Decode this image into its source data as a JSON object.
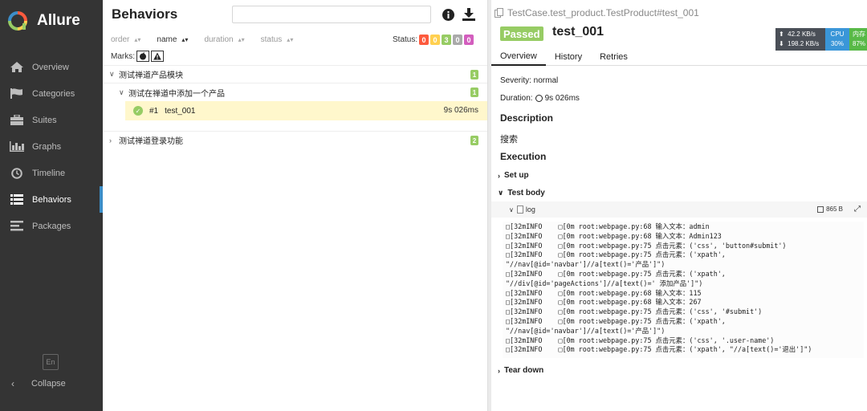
{
  "app": {
    "name": "Allure"
  },
  "sidebar": {
    "items": [
      {
        "label": "Overview",
        "icon": "home-icon"
      },
      {
        "label": "Categories",
        "icon": "flag-icon"
      },
      {
        "label": "Suites",
        "icon": "briefcase-icon"
      },
      {
        "label": "Graphs",
        "icon": "bar-chart-icon"
      },
      {
        "label": "Timeline",
        "icon": "clock-icon"
      },
      {
        "label": "Behaviors",
        "icon": "list-icon",
        "active": true
      },
      {
        "label": "Packages",
        "icon": "align-left-icon"
      }
    ],
    "lang": "En",
    "collapse": "Collapse"
  },
  "behaviors": {
    "title": "Behaviors",
    "search_placeholder": "",
    "sort": {
      "order": "order",
      "name": "name",
      "duration": "duration",
      "status": "status"
    },
    "status_label": "Status:",
    "status_counts": [
      "0",
      "0",
      "3",
      "0",
      "0"
    ],
    "status_colors": [
      "#fd5a3e",
      "#ffd050",
      "#97cc64",
      "#aaaaaa",
      "#d35ebe"
    ],
    "marks_label": "Marks:",
    "tree": {
      "feature1": {
        "label": "测试禅道产品模块",
        "count": "1"
      },
      "story1": {
        "label": "测试在禅道中添加一个产品",
        "count": "1"
      },
      "case1": {
        "num": "#1",
        "name": "test_001",
        "duration": "9s 026ms"
      },
      "feature2": {
        "label": "测试禅道登录功能",
        "count": "2"
      }
    }
  },
  "detail": {
    "path": "TestCase.test_product.TestProduct#test_001",
    "status": "Passed",
    "name": "test_001",
    "monitor": {
      "up": "42.2 KB/s",
      "down": "198.2 KB/s",
      "cpu_label": "CPU",
      "cpu_value": "30%",
      "mem_label": "内存",
      "mem_value": "87%"
    },
    "tabs": [
      "Overview",
      "History",
      "Retries"
    ],
    "severity": "Severity: normal",
    "duration_label": "Duration:",
    "duration_value": "9s 026ms",
    "description_heading": "Description",
    "description": "搜索",
    "execution_heading": "Execution",
    "setup": "Set up",
    "body": "Test body",
    "attachment": {
      "name": "log",
      "size": "865 B"
    },
    "log_lines": [
      "□[32mINFO    □[0m root:webpage.py:68 输入文本：admin",
      "□[32mINFO    □[0m root:webpage.py:68 输入文本：Admin123",
      "□[32mINFO    □[0m root:webpage.py:75 点击元素：('css', 'button#submit')",
      "□[32mINFO    □[0m root:webpage.py:75 点击元素：('xpath',",
      "\"//nav[@id='navbar']//a[text()='产品']\")",
      "□[32mINFO    □[0m root:webpage.py:75 点击元素：('xpath',",
      "\"//div[@id='pageActions']//a[text()=' 添加产品']\")",
      "□[32mINFO    □[0m root:webpage.py:68 输入文本：115",
      "□[32mINFO    □[0m root:webpage.py:68 输入文本：267",
      "□[32mINFO    □[0m root:webpage.py:75 点击元素：('css', '#submit')",
      "□[32mINFO    □[0m root:webpage.py:75 点击元素：('xpath',",
      "\"//nav[@id='navbar']//a[text()='产品']\")",
      "□[32mINFO    □[0m root:webpage.py:75 点击元素：('css', '.user-name')",
      "□[32mINFO    □[0m root:webpage.py:75 点击元素：('xpath', \"//a[text()='退出']\")"
    ],
    "teardown": "Tear down"
  }
}
